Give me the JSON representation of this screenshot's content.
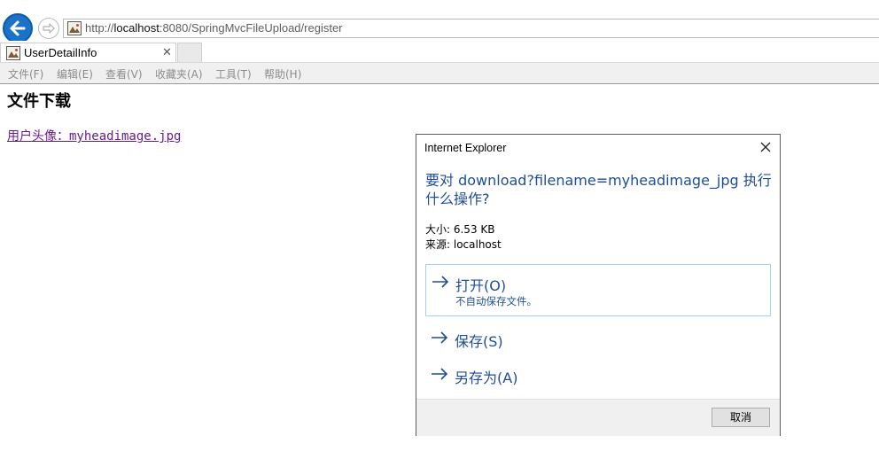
{
  "browser": {
    "url_prefix": "http://",
    "url_host": "localhost",
    "url_rest": ":8080/SpringMvcFileUpload/register",
    "tab_title": "UserDetailInfo",
    "tab_close_glyph": "✕",
    "menu": [
      "文件(F)",
      "编辑(E)",
      "查看(V)",
      "收藏夹(A)",
      "工具(T)",
      "帮助(H)"
    ],
    "icons": [
      "back-arrow-icon",
      "forward-arrow-icon",
      "page-favicon-icon",
      "close-icon"
    ]
  },
  "page": {
    "heading": "文件下载",
    "link_text": "用户头像：myheadimage.jpg"
  },
  "dialog": {
    "title": "Internet Explorer",
    "question": "要对 download?filename=myheadimage_jpg 执行什么操作?",
    "size": "大小: 6.53 KB",
    "source": "来源: localhost",
    "options": [
      {
        "label": "打开(O)",
        "sub": "不自动保存文件。"
      },
      {
        "label": "保存(S)"
      },
      {
        "label": "另存为(A)"
      }
    ],
    "cancel": "取消"
  },
  "colors": {
    "accent_blue": "#1a73c8",
    "dialog_text": "#1e4d99",
    "visited_link": "#6b1b8a",
    "option_border": "#a9d0e8"
  }
}
